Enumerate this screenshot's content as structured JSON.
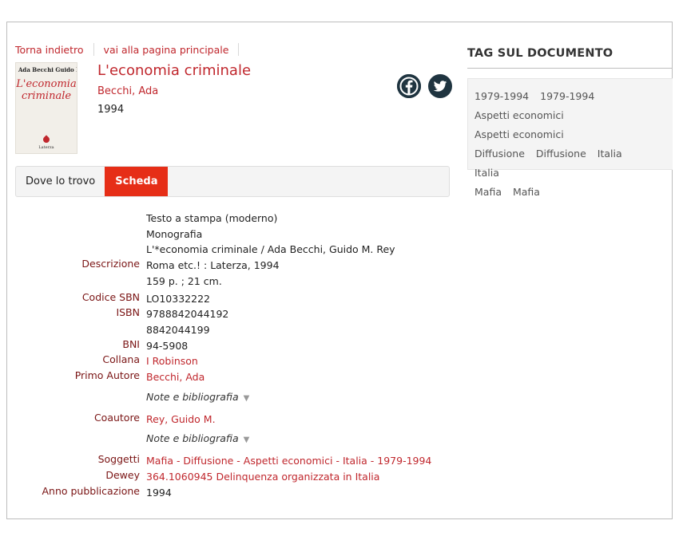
{
  "nav": {
    "back": "Torna indietro",
    "home": "vai alla pagina principale"
  },
  "book": {
    "title": "L'economia criminale",
    "author": "Becchi, Ada",
    "year": "1994",
    "cover": {
      "authors": "Ada Becchi   Guido M. Rey",
      "title_line1": "L'economia",
      "title_line2": "criminale",
      "publisher": "Laterza"
    }
  },
  "social": {
    "facebook_icon": "facebook-icon",
    "twitter_icon": "twitter-icon"
  },
  "tabs": [
    {
      "label": "Dove lo trovo",
      "active": false
    },
    {
      "label": "Scheda",
      "active": true
    }
  ],
  "details": {
    "descrizione_label": "Descrizione",
    "descrizione": [
      "Testo a stampa (moderno)",
      "Monografia",
      "L'*economia criminale / Ada Becchi, Guido M. Rey",
      "Roma etc.! : Laterza, 1994",
      "159 p. ; 21 cm."
    ],
    "sbn_label": "Codice SBN",
    "sbn": "LO10332222",
    "isbn_label": "ISBN",
    "isbn": [
      "9788842044192",
      "8842044199"
    ],
    "bni_label": "BNI",
    "bni": "94-5908",
    "collana_label": "Collana",
    "collana": "I Robinson",
    "primo_autore_label": "Primo Autore",
    "primo_autore": "Becchi, Ada",
    "note_label": "Note e bibliografia",
    "coautore_label": "Coautore",
    "coautore": "Rey, Guido M.",
    "soggetti_label": "Soggetti",
    "soggetti": "Mafia - Diffusione - Aspetti economici - Italia - 1979-1994",
    "dewey_label": "Dewey",
    "dewey": "364.1060945 Delinquenza organizzata in Italia",
    "anno_label": "Anno pubblicazione",
    "anno": "1994"
  },
  "tags": {
    "title": "TAG SUL DOCUMENTO",
    "items": [
      "1979-1994",
      "1979-1994",
      "Aspetti economici",
      "Aspetti economici",
      "Diffusione",
      "Diffusione",
      "Italia",
      "Italia",
      "Mafia",
      "Mafia"
    ]
  }
}
